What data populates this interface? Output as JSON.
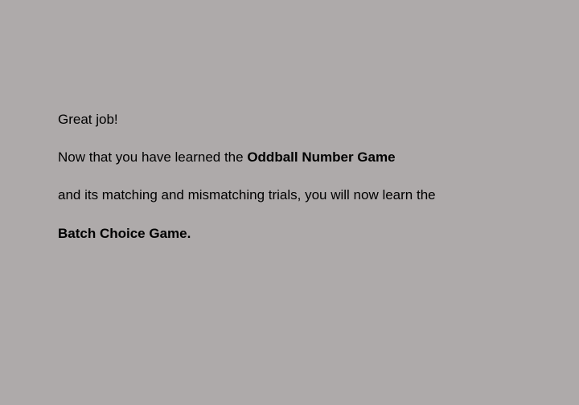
{
  "instructions": {
    "line1": "Great job!",
    "line2_prefix": "Now that you have learned the ",
    "line2_bold": "Oddball Number Game",
    "line3": "and its matching and mismatching trials, you will now learn the",
    "line4_bold": "Batch Choice Game."
  },
  "colors": {
    "background": "#aeaaaa",
    "text": "#000000"
  }
}
